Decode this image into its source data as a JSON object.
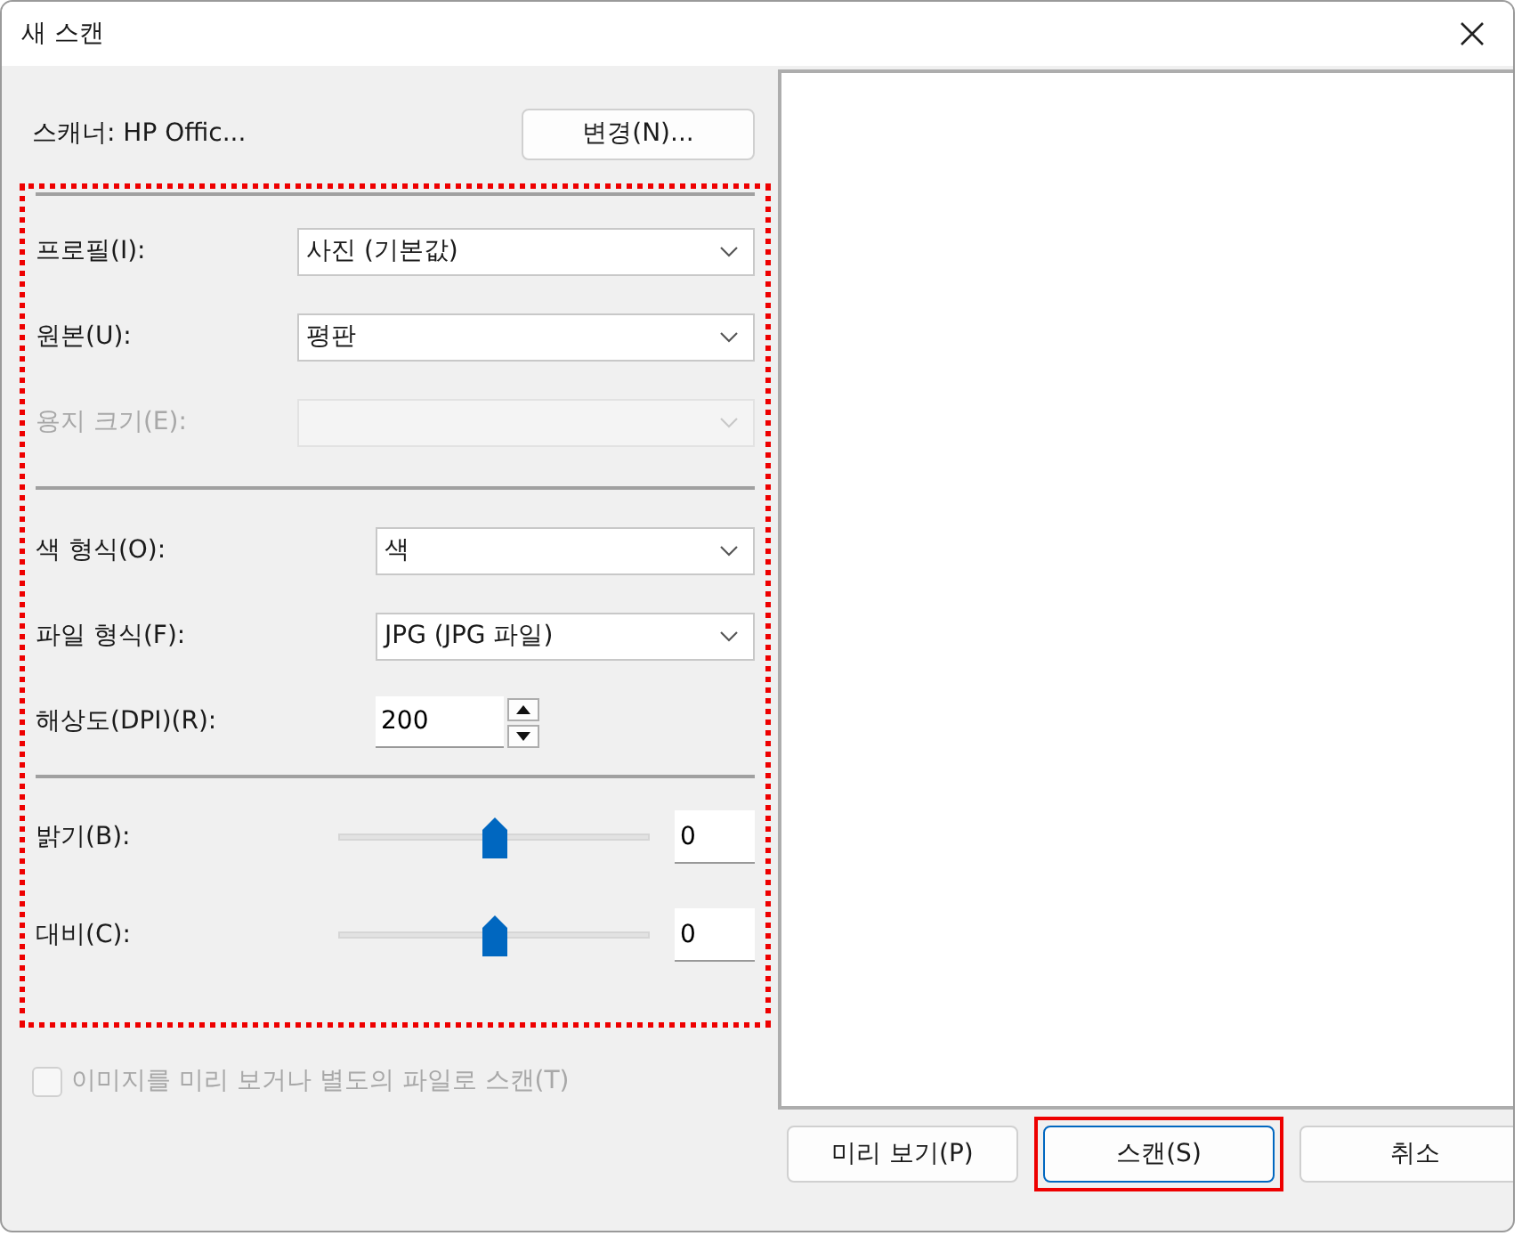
{
  "window": {
    "title": "새 스캔"
  },
  "scanner": {
    "label": "스캐너: HP Offic...",
    "change_button": "변경(N)..."
  },
  "settings": {
    "highlighted": true,
    "groups": [
      [
        {
          "kind": "dropdown",
          "label": "프로필(I):",
          "value": "사진 (기본값)",
          "disabled": false
        },
        {
          "kind": "dropdown",
          "label": "원본(U):",
          "value": "평판",
          "disabled": false
        },
        {
          "kind": "dropdown",
          "label": "용지 크기(E):",
          "disabled": true
        }
      ],
      [
        {
          "kind": "dropdown",
          "label": "색 형식(O):",
          "value": "색",
          "disabled": false
        },
        {
          "kind": "dropdown",
          "label": "파일 형식(F):",
          "value": "JPG (JPG 파일)",
          "disabled": false
        },
        {
          "kind": "spinner",
          "label": "해상도(DPI)(R):",
          "value": "200"
        }
      ],
      [
        {
          "kind": "slider",
          "label": "밝기(B):",
          "level": 0.5,
          "value": "0"
        },
        {
          "kind": "slider",
          "label": "대비(C):",
          "level": 0.5,
          "value": "0"
        }
      ]
    ]
  },
  "preview_option": {
    "label": "이미지를 미리 보거나 별도의 파일로 스캔(T)",
    "checked": false,
    "disabled": true
  },
  "buttons": [
    {
      "label": "미리 보기(P)",
      "focused": false,
      "highlighted": false
    },
    {
      "label": "스캔(S)",
      "focused": true,
      "highlighted": true
    },
    {
      "label": "취소",
      "focused": false,
      "highlighted": false
    }
  ]
}
